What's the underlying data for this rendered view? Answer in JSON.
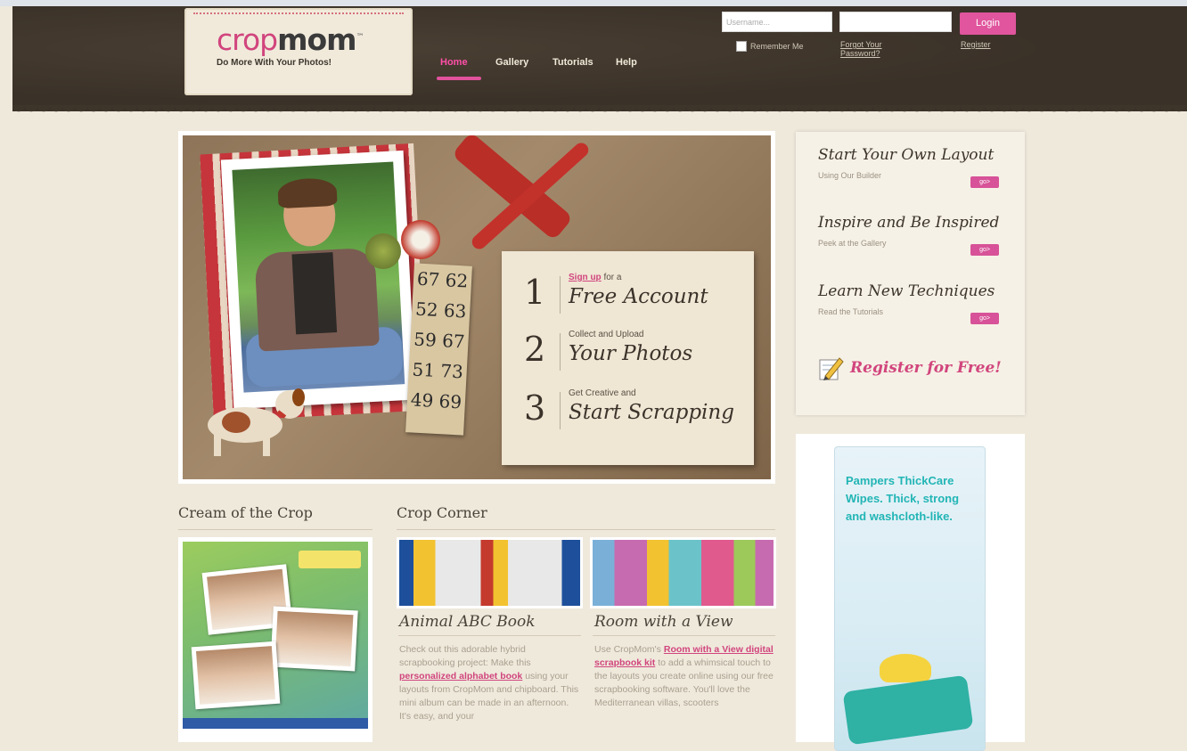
{
  "header": {
    "logo_crop": "cropmom",
    "logo_crop_part": "crop",
    "logo_mom_part": "mom",
    "logo_tm": "™",
    "tagline": "Do More With Your Photos!",
    "nav": [
      "Home",
      "Gallery",
      "Tutorials",
      "Help"
    ],
    "active_nav": "Home",
    "username_placeholder": "Username...",
    "login_label": "Login",
    "remember_me": "Remember Me",
    "forgot_password": "Forgot Your Password?",
    "register": "Register"
  },
  "hero": {
    "steps": [
      {
        "number": "1",
        "link": "Sign up",
        "small": " for a",
        "big": "Free Account"
      },
      {
        "number": "2",
        "link": "",
        "small": "Collect and Upload",
        "big": "Your Photos"
      },
      {
        "number": "3",
        "link": "",
        "small": "Get Creative and",
        "big": "Start Scrapping"
      }
    ],
    "bingo_numbers": [
      "67 62",
      "52 63",
      "59 67",
      "51 73",
      "49 69"
    ]
  },
  "sidebar": {
    "items": [
      {
        "title": "Start Your Own Layout",
        "sub": "Using Our Builder",
        "go": "go>"
      },
      {
        "title": "Inspire and Be Inspired",
        "sub": "Peek at the Gallery",
        "go": "go>"
      },
      {
        "title": "Learn New Techniques",
        "sub": "Read the Tutorials",
        "go": "go>"
      }
    ],
    "register_cta": "Register for Free!"
  },
  "ad": {
    "text": "Pampers ThickCare Wipes. Thick, strong and washcloth-like."
  },
  "cream": {
    "title": "Cream of the Crop"
  },
  "corner": {
    "title": "Crop Corner",
    "articles": [
      {
        "title": "Animal ABC Book",
        "text_before": "Check out this adorable hybrid scrapbooking project: Make this ",
        "link": "personalized alphabet book",
        "text_after": " using your layouts from CropMom and chipboard. This mini album can be made in an afternoon. It's easy, and your"
      },
      {
        "title": "Room with a View",
        "text_before": "Use CropMom's ",
        "link": "Room with a View digital scrapbook kit",
        "text_after": " to add a whimsical touch to the layouts you create online using our free scrapbooking software. You'll love the Mediterranean villas, scooters"
      }
    ]
  },
  "colors": {
    "brand_pink": "#d1457d",
    "header_brown": "#3d342a",
    "page_bg": "#efe9dc"
  }
}
